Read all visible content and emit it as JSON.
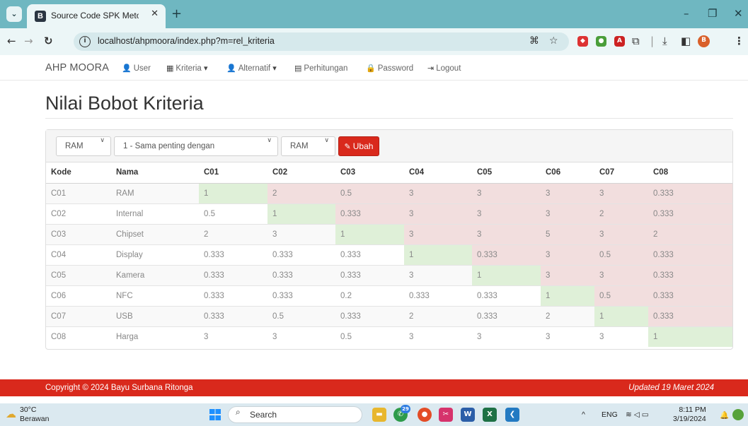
{
  "browser": {
    "tab_title": "Source Code SPK Metode AHP",
    "tab_favicon": "B",
    "url": "localhost/ahpmoora/index.php?m=rel_kriteria",
    "profile_initial": "B"
  },
  "nav": {
    "brand": "AHP MOORA",
    "links": [
      "User",
      "Kriteria",
      "Alternatif",
      "Perhitungan",
      "Password",
      "Logout"
    ]
  },
  "page": {
    "title": "Nilai Bobot Kriteria"
  },
  "form": {
    "select1": "RAM",
    "select2": "1 - Sama penting dengan",
    "select3": "RAM",
    "button": "Ubah"
  },
  "table": {
    "headers": [
      "Kode",
      "Nama",
      "C01",
      "C02",
      "C03",
      "C04",
      "C05",
      "C06",
      "C07",
      "C08"
    ],
    "rows": [
      [
        "C01",
        "RAM",
        "1",
        "2",
        "0.5",
        "3",
        "3",
        "3",
        "3",
        "0.333"
      ],
      [
        "C02",
        "Internal",
        "0.5",
        "1",
        "0.333",
        "3",
        "3",
        "3",
        "2",
        "0.333"
      ],
      [
        "C03",
        "Chipset",
        "2",
        "3",
        "1",
        "3",
        "3",
        "5",
        "3",
        "2"
      ],
      [
        "C04",
        "Display",
        "0.333",
        "0.333",
        "0.333",
        "1",
        "0.333",
        "3",
        "0.5",
        "0.333"
      ],
      [
        "C05",
        "Kamera",
        "0.333",
        "0.333",
        "0.333",
        "3",
        "1",
        "3",
        "3",
        "0.333"
      ],
      [
        "C06",
        "NFC",
        "0.333",
        "0.333",
        "0.2",
        "0.333",
        "0.333",
        "1",
        "0.5",
        "0.333"
      ],
      [
        "C07",
        "USB",
        "0.333",
        "0.5",
        "0.333",
        "2",
        "0.333",
        "2",
        "1",
        "0.333"
      ],
      [
        "C08",
        "Harga",
        "3",
        "3",
        "0.5",
        "3",
        "3",
        "3",
        "3",
        "1"
      ]
    ]
  },
  "footer": {
    "copyright": "Copyright © 2024 Bayu Surbana Ritonga",
    "updated": "Updated 19 Maret 2024"
  },
  "taskbar": {
    "temp": "30°C",
    "weather": "Berawan",
    "search": "Search",
    "badge": "29",
    "lang": "ENG",
    "time": "8:11 PM",
    "date": "3/19/2024"
  },
  "colors": {
    "accent_red": "#d9291c",
    "diag_green": "#dff0d8",
    "upper_red": "#f2dede",
    "chrome": "#6fb7c1"
  }
}
